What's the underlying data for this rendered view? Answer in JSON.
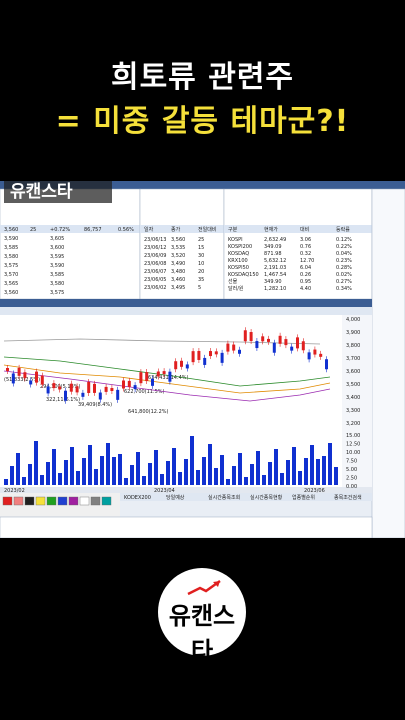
{
  "headline": {
    "line1": "희토류 관련주",
    "line2": "= 미중 갈등 테마군?!"
  },
  "watermark": {
    "text": "유캔스타"
  },
  "logo": {
    "text": "유캔스타"
  },
  "left_panel": {
    "rows": [
      {
        "a": "3,560",
        "b": "25",
        "c": "+0.72%",
        "d": "86,757",
        "e": "0.56%"
      },
      {
        "a": "3,590",
        "b": "",
        "c": "3,605",
        "d": "",
        "e": ""
      },
      {
        "a": "3,585",
        "b": "",
        "c": "3,600",
        "d": "",
        "e": ""
      },
      {
        "a": "3,580",
        "b": "",
        "c": "3,595",
        "d": "",
        "e": ""
      },
      {
        "a": "3,575",
        "b": "",
        "c": "3,590",
        "d": "",
        "e": ""
      },
      {
        "a": "3,570",
        "b": "",
        "c": "3,585",
        "d": "",
        "e": ""
      },
      {
        "a": "3,565",
        "b": "",
        "c": "3,580",
        "d": "",
        "e": ""
      },
      {
        "a": "3,560",
        "b": "",
        "c": "3,575",
        "d": "",
        "e": ""
      }
    ]
  },
  "date_panel": {
    "header": [
      "일자",
      "종가",
      "전일대비"
    ],
    "rows": [
      [
        "23/06/13",
        "3,560",
        "25"
      ],
      [
        "23/06/12",
        "3,535",
        "15"
      ],
      [
        "23/06/09",
        "3,520",
        "30"
      ],
      [
        "23/06/08",
        "3,490",
        "10"
      ],
      [
        "23/06/07",
        "3,480",
        "20"
      ],
      [
        "23/06/05",
        "3,460",
        "35"
      ],
      [
        "23/06/02",
        "3,495",
        "5"
      ]
    ]
  },
  "index_panel": {
    "header": [
      "구분",
      "현재가",
      "대비",
      "등락률"
    ],
    "rows": [
      [
        "KOSPI",
        "2,632.49",
        "3.06",
        "0.12%"
      ],
      [
        "KOSPI200",
        "349.09",
        "0.76",
        "0.22%"
      ],
      [
        "KOSDAQ",
        "871.98",
        "0.32",
        "0.04%"
      ],
      [
        "KRX100",
        "5,632.12",
        "12.70",
        "0.23%"
      ],
      [
        "KOSPI50",
        "2,191.03",
        "6.04",
        "0.28%"
      ],
      [
        "KOSDAQ150",
        "1,467.54",
        "0.26",
        "0.02%"
      ],
      [
        "선물",
        "349.90",
        "0.95",
        "0.27%"
      ],
      [
        "달러/원",
        "1,282.10",
        "4.40",
        "0.34%"
      ]
    ]
  },
  "chart_annotations": {
    "a1": "(51,833(2.5%)",
    "a2": "294,300(5.13%)",
    "a3": "322,11(6.1%)",
    "a4": "39,409(8.4%)",
    "a5": "622,700(11.5%)",
    "a6": "641,800(12.2%)",
    "a7": "634,431(14.4%)"
  },
  "price_axis": [
    "4,000",
    "3,900",
    "3,800",
    "3,700",
    "3,600",
    "3,500",
    "3,400",
    "3,300",
    "3,200"
  ],
  "volume_axis": [
    "15.00",
    "12.50",
    "10.00",
    "7.50",
    "5.00",
    "2.50",
    "0.00"
  ],
  "x_labels": [
    "2023/02",
    "2023/04",
    "2023/06"
  ],
  "bottom_tabs": [
    "KODEX200",
    "당일예상",
    "실시간종목조회",
    "실시간종목현황",
    "업종별순위",
    "종목조건검색"
  ],
  "colors": {
    "up": "#e02020",
    "down": "#1030d0",
    "headline_yellow": "#f5e03a"
  }
}
